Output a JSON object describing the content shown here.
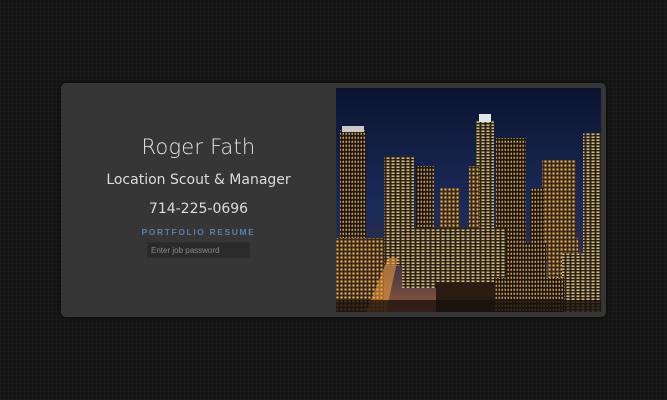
{
  "profile": {
    "name": "Roger Fath",
    "title": "Location Scout & Manager",
    "phone": "714-225-0696"
  },
  "links": {
    "portfolio": "PORTFOLIO",
    "resume": "RESUME"
  },
  "password": {
    "placeholder": "Enter job password"
  },
  "image": {
    "subject": "night city skyline"
  },
  "colors": {
    "background": "#151515",
    "card": "#363636",
    "link": "#5c7ea8",
    "text": "#e4e4e4"
  }
}
